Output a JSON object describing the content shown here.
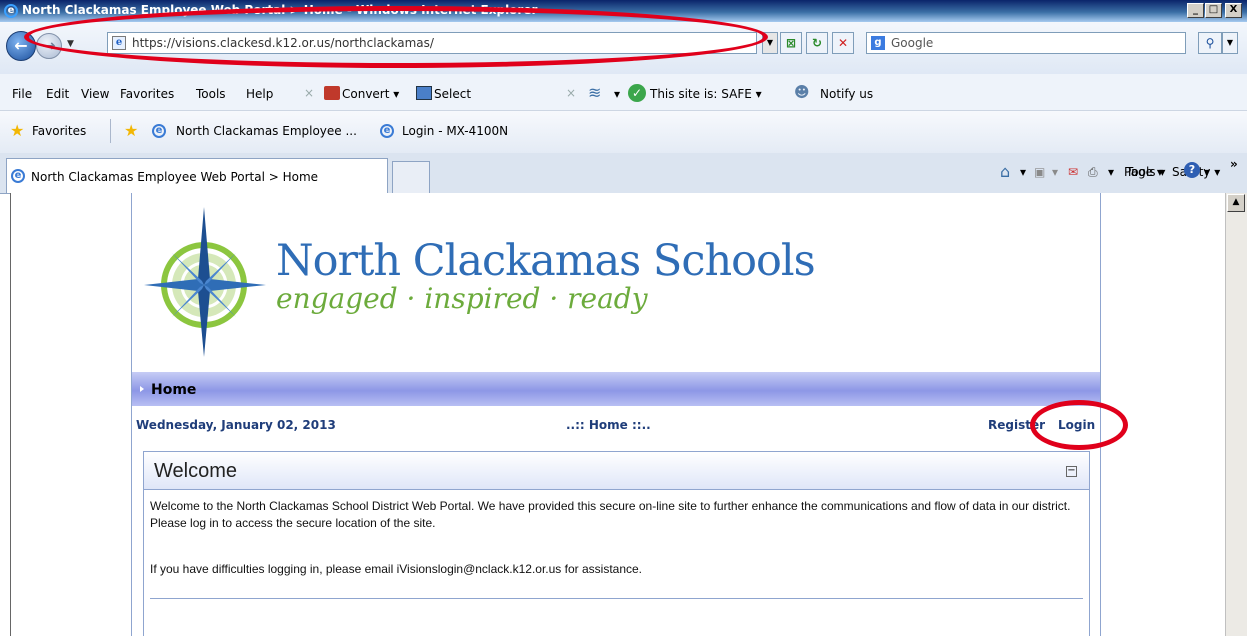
{
  "window": {
    "title": "North Clackamas Employee Web Portal > Home - Windows Internet Explorer",
    "min_label": "_",
    "max_label": "□",
    "close_label": "X"
  },
  "address_bar": {
    "url": "https://visions.clackesd.k12.or.us/northclackamas/",
    "search_placeholder": "Google"
  },
  "menu": {
    "items": [
      "File",
      "Edit",
      "View",
      "Favorites",
      "Tools",
      "Help"
    ],
    "convert_label": "Convert",
    "select_label": "Select",
    "safe_label": "This site is: SAFE",
    "notify_label": "Notify us"
  },
  "favorites_bar": {
    "favorites_label": "Favorites",
    "items": [
      "North Clackamas Employee ...",
      "Login - MX-4100N"
    ]
  },
  "tabs": {
    "active_tab": "North Clackamas Employee Web Portal > Home"
  },
  "command_bar": {
    "page_label": "Page",
    "safety_label": "Safety",
    "tools_label": "Tools"
  },
  "logo": {
    "title": "North Clackamas Schools",
    "tagline": "engaged · inspired · ready"
  },
  "nav": {
    "home_label": "Home"
  },
  "info_bar": {
    "date": "Wednesday, January 02, 2013",
    "breadcrumb": "..:: Home ::..",
    "register_label": "Register",
    "login_label": "Login"
  },
  "welcome": {
    "title": "Welcome",
    "paragraph1": "Welcome to the North Clackamas School District  Web Portal.  We have provided this secure on-line site to further enhance the communications and flow of data in our district.  Please log in to access the secure location of the site.",
    "paragraph2": "If you have difficulties logging in, please email iVisionslogin@nclack.k12.or.us for assistance."
  },
  "colors": {
    "annotation_red": "#e0001b",
    "portal_link_blue": "#1f3d7a",
    "logo_blue": "#2f6db6",
    "logo_green": "#6cab3c",
    "nav_purple": "#8d97e6"
  }
}
